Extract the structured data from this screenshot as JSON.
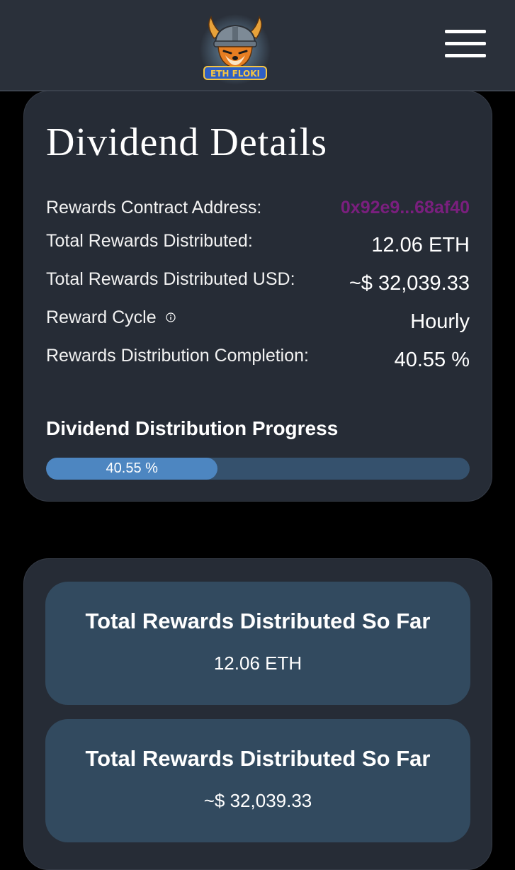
{
  "header": {
    "logo_text": "ETH FLOKI",
    "logo_icon": "shiba-viking-logo",
    "menu_icon": "hamburger-menu-icon"
  },
  "details": {
    "title": "Dividend Details",
    "rows": [
      {
        "label": "Rewards Contract Address:",
        "value": "0x92e9...68af40"
      },
      {
        "label": "Total Rewards Distributed:",
        "value": "12.06 ETH"
      },
      {
        "label": "Total Rewards Distributed USD:",
        "value": "~$ 32,039.33"
      },
      {
        "label": "Reward Cycle",
        "value": "Hourly",
        "icon": "info-icon"
      },
      {
        "label": "Rewards Distribution Completion:",
        "value": "40.55 %"
      }
    ],
    "progress_title": "Dividend Distribution Progress",
    "progress_percent": 40.55,
    "progress_label": "40.55 %"
  },
  "totals": [
    {
      "title": "Total Rewards Distributed So Far",
      "value": "12.06 ETH"
    },
    {
      "title": "Total Rewards Distributed So Far",
      "value": "~$ 32,039.33"
    }
  ],
  "colors": {
    "background": "#000000",
    "header": "#2a303a",
    "card": "#262c36",
    "stat_card": "#324a5f",
    "address_link": "#7a1f7e",
    "progress_track": "#35516d",
    "progress_fill": "#4d86c1"
  }
}
